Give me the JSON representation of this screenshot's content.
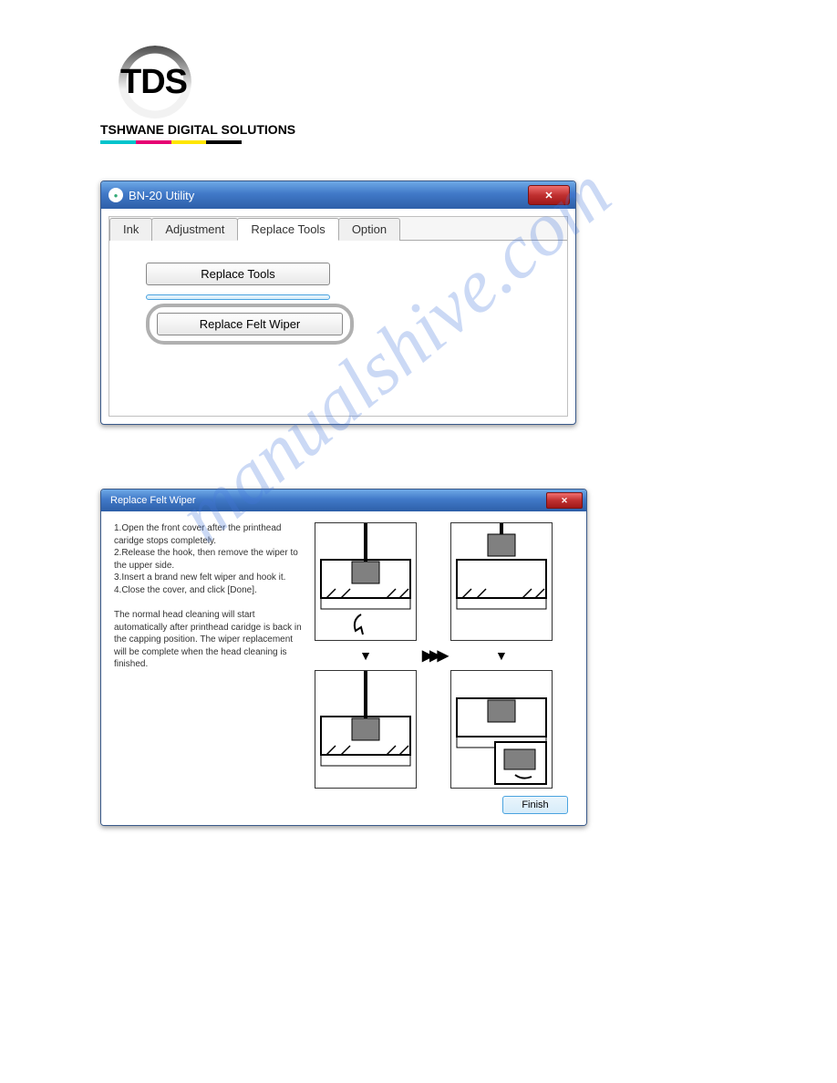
{
  "logo": {
    "abbrev": "TDS",
    "full": "TSHWANE DIGITAL SOLUTIONS"
  },
  "watermark": "manualshive.com",
  "utility_window": {
    "title": "BN-20 Utility",
    "tabs": [
      "Ink",
      "Adjustment",
      "Replace Tools",
      "Option"
    ],
    "active_tab_index": 2,
    "buttons": {
      "replace_tools": "Replace Tools",
      "replace_felt_wiper": "Replace Felt Wiper"
    }
  },
  "felt_wiper_window": {
    "title": "Replace Felt Wiper",
    "instructions": [
      "1.Open the front cover after the printhead caridge stops completely.",
      "2.Release the hook, then remove the wiper to the upper side.",
      "3.Insert a brand new felt wiper and hook it.",
      "4.Close the cover, and click [Done]."
    ],
    "note": "The normal head cleaning will start automatically after printhead caridge is back in the capping position. The wiper replacement will be complete when the head cleaning is finished.",
    "arrow_right": "▶▶▶",
    "arrow_down": "▼",
    "finish_button": "Finish"
  }
}
